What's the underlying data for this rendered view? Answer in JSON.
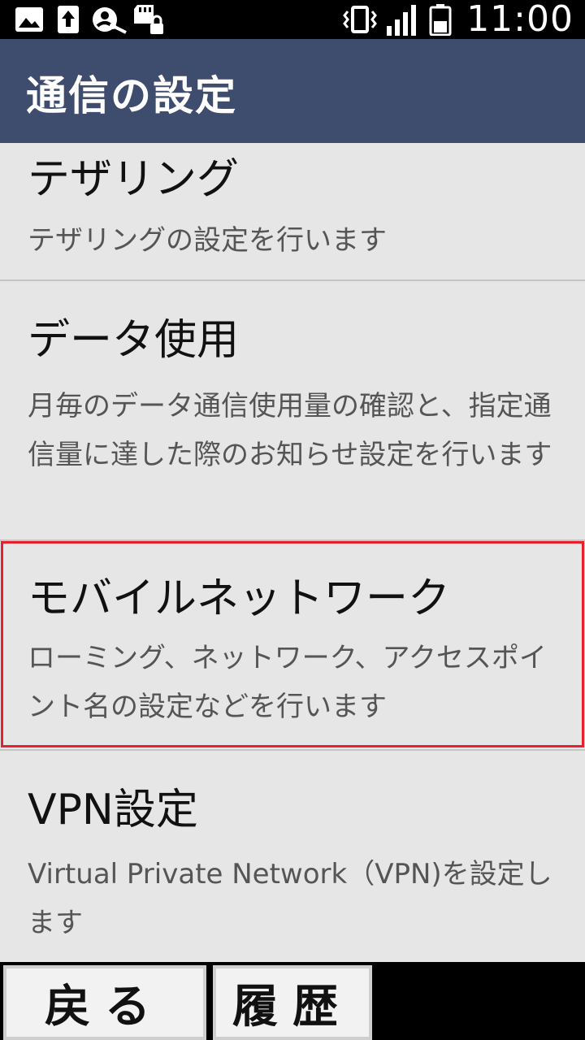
{
  "status_bar": {
    "time": "11:00",
    "icons": [
      "image-notification-icon",
      "upload-icon",
      "account-key-icon",
      "sd-card-lock-icon",
      "vibrate-icon",
      "signal-icon",
      "battery-icon"
    ]
  },
  "header": {
    "title": "通信の設定"
  },
  "settings_items": [
    {
      "title": "テザリング",
      "description": "テザリングの設定を行います"
    },
    {
      "title": "データ使用",
      "description": "月毎のデータ通信使用量の確認と、指定通信量に達した際のお知らせ設定を行います"
    },
    {
      "title": "モバイルネットワーク",
      "description": "ローミング、ネットワーク、アクセスポイント名の設定などを行います"
    },
    {
      "title": "VPN設定",
      "description": "Virtual Private Network（VPN)を設定します"
    }
  ],
  "soft_keys": {
    "back_label": "戻る",
    "history_label": "履歴"
  },
  "colors": {
    "header_bg": "#3e4d6e",
    "content_bg": "#e6e6e6",
    "highlight_border": "#e8202e"
  }
}
